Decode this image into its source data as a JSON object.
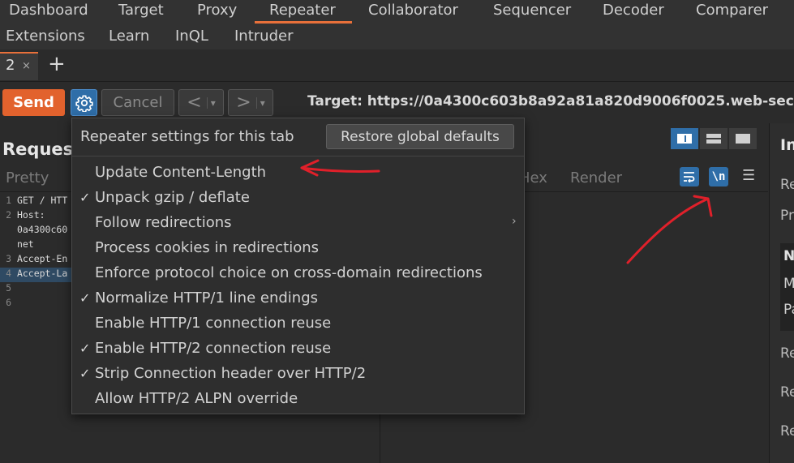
{
  "nav": {
    "row1": [
      "Dashboard",
      "Target",
      "Proxy",
      "Repeater",
      "Collaborator",
      "Sequencer",
      "Decoder",
      "Comparer"
    ],
    "row2": [
      "Extensions",
      "Learn",
      "InQL",
      "Intruder"
    ]
  },
  "tabs": [
    {
      "label": "2",
      "close": "×"
    }
  ],
  "add_tab": "+",
  "toolbar": {
    "send": "Send",
    "cancel": "Cancel",
    "back": "<",
    "forward": ">",
    "dropdown": "▾",
    "target": "Target: https://0a4300c603b8a92a81a820d9006f0025.web-secu"
  },
  "request": {
    "title": "Reques",
    "tab_pretty": "Pretty",
    "lines": [
      {
        "num": "1",
        "text": "GET / HTT"
      },
      {
        "num": "2",
        "text": "Host:"
      },
      {
        "num": "",
        "text": "0a4300c60"
      },
      {
        "num": "",
        "text": "net"
      },
      {
        "num": "3",
        "text": "Accept-En"
      },
      {
        "num": "4",
        "text": "Accept-La"
      },
      {
        "num": "5",
        "text": ""
      },
      {
        "num": "6",
        "text": ""
      }
    ]
  },
  "response": {
    "tab_hex": "Hex",
    "tab_render": "Render",
    "newline_button": "\\n",
    "menu_icon": "☰"
  },
  "inspector": {
    "title": "In",
    "rows": [
      "Re",
      "Pr",
      "N",
      "M",
      "Pa",
      "Re",
      "Re",
      "Re"
    ]
  },
  "menu": {
    "title": "Repeater settings for this tab",
    "restore": "Restore global defaults",
    "items": [
      {
        "label": "Update Content-Length",
        "checked": false,
        "submenu": false
      },
      {
        "label": "Unpack gzip / deflate",
        "checked": true,
        "submenu": false
      },
      {
        "label": "Follow redirections",
        "checked": false,
        "submenu": true
      },
      {
        "label": "Process cookies in redirections",
        "checked": false,
        "submenu": false
      },
      {
        "label": "Enforce protocol choice on cross-domain redirections",
        "checked": false,
        "submenu": false
      },
      {
        "label": "Normalize HTTP/1 line endings",
        "checked": true,
        "submenu": false
      },
      {
        "label": "Enable HTTP/1 connection reuse",
        "checked": false,
        "submenu": false
      },
      {
        "label": "Enable HTTP/2 connection reuse",
        "checked": true,
        "submenu": false
      },
      {
        "label": "Strip Connection header over HTTP/2",
        "checked": true,
        "submenu": false
      },
      {
        "label": "Allow HTTP/2 ALPN override",
        "checked": false,
        "submenu": false
      }
    ],
    "check_glyph": "✓",
    "chevron_glyph": "›"
  },
  "colors": {
    "accent": "#e8703a",
    "blue": "#2f6ea8",
    "annotation": "#e0202a"
  }
}
